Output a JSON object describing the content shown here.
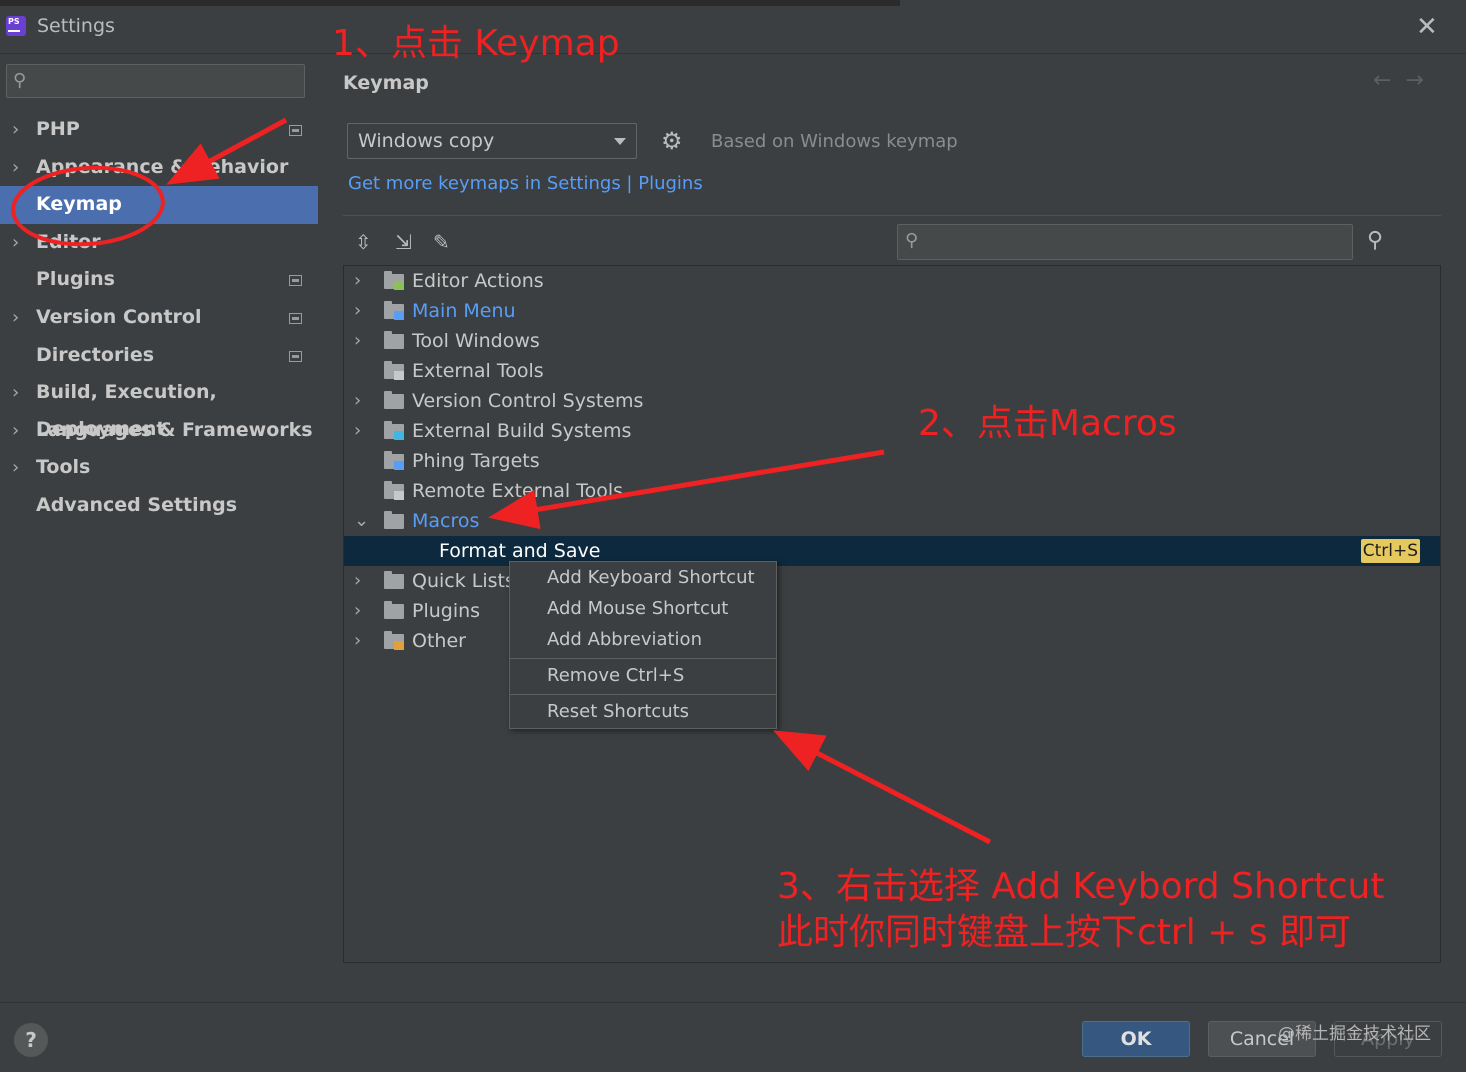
{
  "window": {
    "title": "Settings",
    "app_icon": "phpstorm-icon",
    "close_icon": "close-icon"
  },
  "sidebar": {
    "search_placeholder": "",
    "items": [
      {
        "label": "PHP",
        "expandable": true,
        "project_icon": true
      },
      {
        "label": "Appearance & Behavior",
        "expandable": true,
        "project_icon": false
      },
      {
        "label": "Keymap",
        "expandable": false,
        "selected": true,
        "project_icon": false
      },
      {
        "label": "Editor",
        "expandable": true,
        "project_icon": false
      },
      {
        "label": "Plugins",
        "expandable": false,
        "project_icon": true
      },
      {
        "label": "Version Control",
        "expandable": true,
        "project_icon": true
      },
      {
        "label": "Directories",
        "expandable": false,
        "project_icon": true
      },
      {
        "label": "Build, Execution, Deployment",
        "expandable": true,
        "project_icon": false
      },
      {
        "label": "Languages & Frameworks",
        "expandable": true,
        "project_icon": false
      },
      {
        "label": "Tools",
        "expandable": true,
        "project_icon": false
      },
      {
        "label": "Advanced Settings",
        "expandable": false,
        "project_icon": false
      }
    ]
  },
  "main": {
    "heading": "Keymap",
    "keymap_select": {
      "value": "Windows copy"
    },
    "based_on": "Based on Windows keymap",
    "more_link": "Get more keymaps in Settings | Plugins",
    "tree": [
      {
        "label": "Editor Actions",
        "expandable": true,
        "style": "normal"
      },
      {
        "label": "Main Menu",
        "expandable": true,
        "style": "blue"
      },
      {
        "label": "Tool Windows",
        "expandable": true,
        "style": "normal"
      },
      {
        "label": "External Tools",
        "expandable": false,
        "style": "normal"
      },
      {
        "label": "Version Control Systems",
        "expandable": true,
        "style": "normal"
      },
      {
        "label": "External Build Systems",
        "expandable": true,
        "style": "normal"
      },
      {
        "label": "Phing Targets",
        "expandable": false,
        "style": "normal"
      },
      {
        "label": "Remote External Tools",
        "expandable": false,
        "style": "normal"
      },
      {
        "label": "Macros",
        "expandable": true,
        "expanded": true,
        "style": "blue"
      },
      {
        "label": "Format and Save",
        "child": true,
        "selected": true,
        "shortcut": "Ctrl+S"
      },
      {
        "label": "Quick Lists",
        "expandable": true,
        "style": "normal"
      },
      {
        "label": "Plugins",
        "expandable": true,
        "style": "normal"
      },
      {
        "label": "Other",
        "expandable": true,
        "style": "normal"
      }
    ],
    "context_menu": [
      "Add Keyboard Shortcut",
      "Add Mouse Shortcut",
      "Add Abbreviation",
      "Remove Ctrl+S",
      "Reset Shortcuts"
    ]
  },
  "footer": {
    "help": "?",
    "ok": "OK",
    "cancel": "Cancel",
    "apply": "Apply",
    "watermark": "@稀土掘金技术社区"
  },
  "annotations": {
    "step1": "1、点击 Keymap",
    "step2": "2、点击Macros",
    "step3_line1": "3、右击选择 Add Keybord Shortcut",
    "step3_line2": "此时你同时键盘上按下ctrl + s 即可",
    "color": "#ee2222"
  },
  "colors": {
    "selection": "#4b6eaf",
    "tree_selection": "#0d293e",
    "link": "#589df6",
    "shortcut_chip": "#e6c95e"
  }
}
